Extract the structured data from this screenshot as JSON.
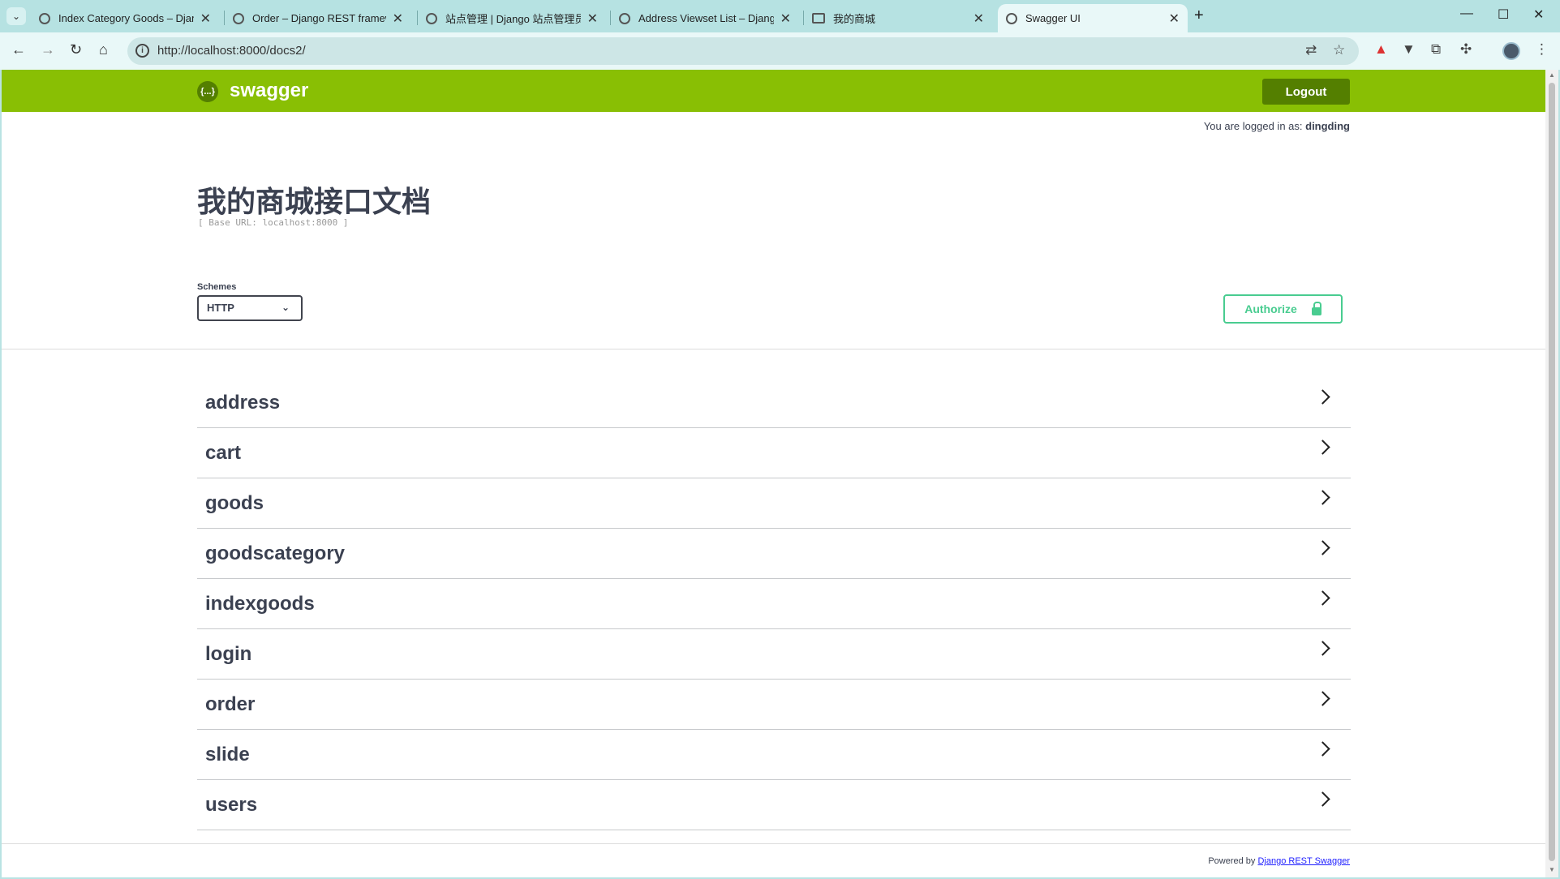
{
  "browser": {
    "tabs": [
      {
        "title": "Index Category Goods – Djan"
      },
      {
        "title": "Order – Django REST framew"
      },
      {
        "title": "站点管理 | Django 站点管理员"
      },
      {
        "title": "Address Viewset List – Djang"
      },
      {
        "title": "我的商城"
      },
      {
        "title": "Swagger UI"
      }
    ],
    "new_tab": "+",
    "url": "http://localhost:8000/docs2/"
  },
  "header": {
    "brand": "swagger",
    "logo_glyph": "{...}",
    "logout_label": "Logout",
    "logged_in_prefix": "You are logged in as:",
    "username": "dingding"
  },
  "info": {
    "title": "我的商城接口文档",
    "base_url": "[ Base URL: localhost:8000 ]"
  },
  "schemes": {
    "label": "Schemes",
    "selected": "HTTP"
  },
  "authorize_label": "Authorize",
  "tags": [
    "address",
    "cart",
    "goods",
    "goodscategory",
    "indexgoods",
    "login",
    "order",
    "slide",
    "users"
  ],
  "footer": {
    "powered_by": "Powered by",
    "link_text": "Django REST Swagger"
  },
  "colors": {
    "header_green": "#89bf04",
    "dark_green": "#547f00",
    "authorize_green": "#49cc90",
    "text": "#3b4151"
  }
}
